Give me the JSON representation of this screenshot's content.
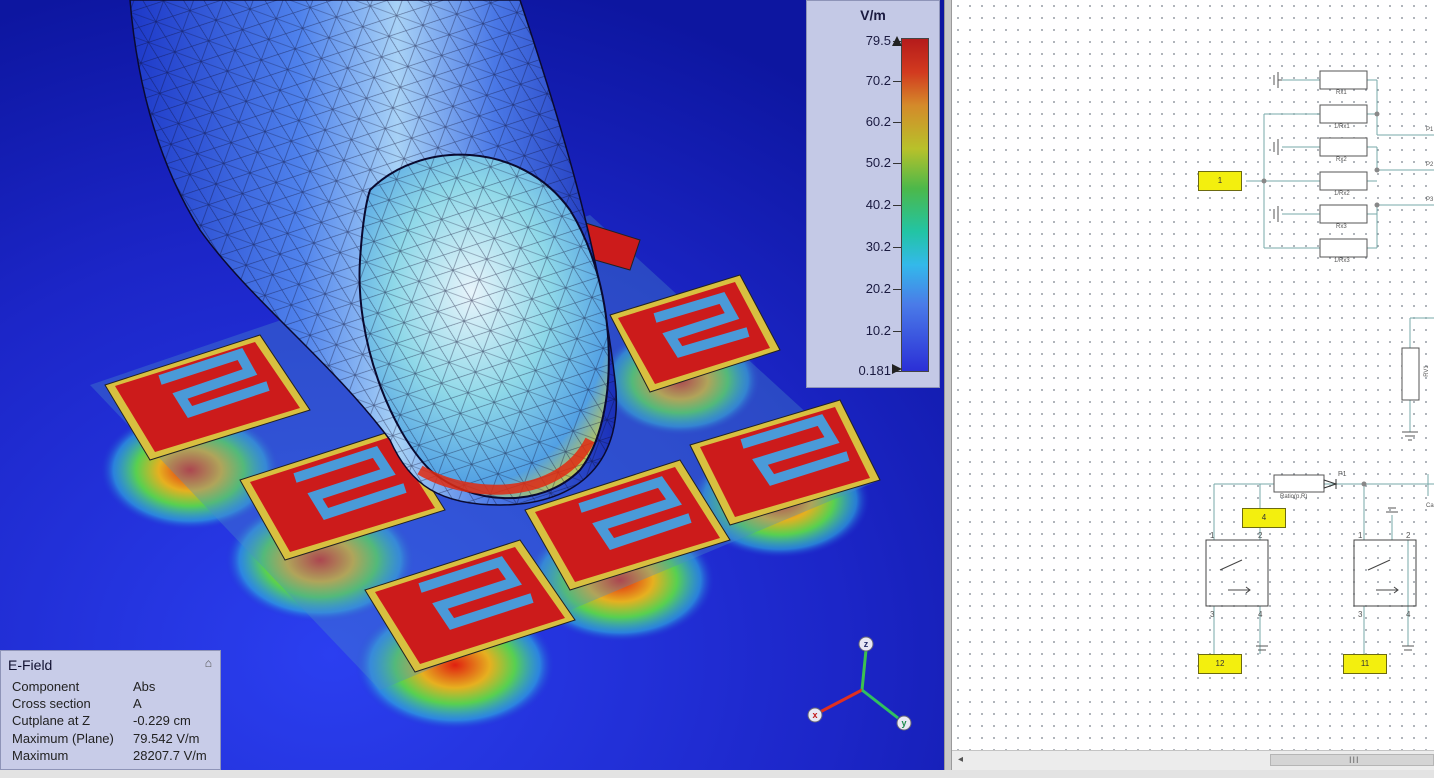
{
  "legend": {
    "unit": "V/m",
    "ticks": [
      "79.5",
      "70.2",
      "60.2",
      "50.2",
      "40.2",
      "30.2",
      "20.2",
      "10.2",
      "0.181"
    ]
  },
  "info": {
    "title": "E-Field",
    "rows": [
      {
        "key": "Component",
        "value": "Abs"
      },
      {
        "key": "Cross section",
        "value": "A"
      },
      {
        "key": "Cutplane at Z",
        "value": "-0.229 cm"
      },
      {
        "key": "Maximum (Plane)",
        "value": "79.542 V/m"
      },
      {
        "key": "Maximum",
        "value": "28207.7 V/m"
      }
    ]
  },
  "axes": {
    "z": "z",
    "x": "x",
    "y": "y"
  },
  "schematic": {
    "inputs": [
      "1",
      "4",
      "12",
      "11"
    ],
    "resistors": [
      "Rx1",
      "1/Rx1",
      "Rx2",
      "1/Rx2",
      "Rx3",
      "1/Rx3"
    ],
    "edge_labels": [
      "P1",
      "P2",
      "P3"
    ],
    "rv_label": "RV1",
    "ratio_label": "Ratio(p,R)",
    "p1_label": "P1",
    "cap_label": "Ca",
    "pins": [
      "1",
      "2",
      "3",
      "4"
    ]
  },
  "scrollbar": {
    "left_arrow": "◂",
    "grip": "III"
  },
  "colors": {
    "background_blue": "#1b2bd0",
    "field_red": "#c8141a",
    "field_yellow": "#e0e020",
    "field_green": "#3cc85a",
    "legend_panel": "#c4c9e6",
    "input_yellow": "#f3ef0e"
  }
}
